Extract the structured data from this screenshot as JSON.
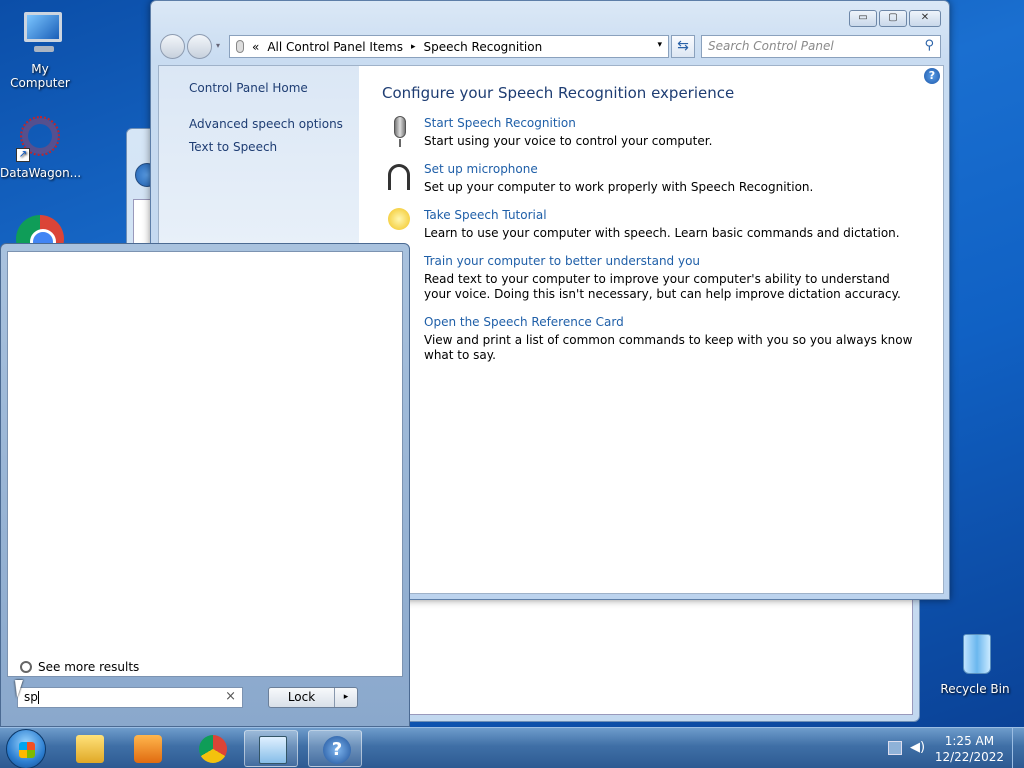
{
  "desktop": {
    "icons": [
      {
        "label": "My Computer"
      },
      {
        "label": "DataWagon..."
      },
      {
        "label": "Recycle Bin"
      }
    ]
  },
  "window": {
    "caption": {
      "minimize": "▭",
      "maximize": "▢",
      "close": "✕"
    },
    "address": {
      "chevrons": "«",
      "crumb1": "All Control Panel Items",
      "separator": "▸",
      "crumb2": "Speech Recognition",
      "dropdown": "▾"
    },
    "refresh": "⇆",
    "search_placeholder": "Search Control Panel",
    "search_icon": "⚲",
    "left_links": [
      "Control Panel Home",
      "Advanced speech options",
      "Text to Speech"
    ],
    "help": "?",
    "heading": "Configure your Speech Recognition experience",
    "tasks": [
      {
        "icon": "microphone-icon",
        "link": "Start Speech Recognition",
        "desc": "Start using your voice to control your computer."
      },
      {
        "icon": "headset-icon",
        "link": "Set up microphone",
        "desc": "Set up your computer to work properly with Speech Recognition."
      },
      {
        "icon": "lightbulb-icon",
        "link": "Take Speech Tutorial",
        "desc": "Learn to use your computer with speech.  Learn basic commands and dictation."
      },
      {
        "icon": "none",
        "link": "Train your computer to better understand you",
        "desc": "Read text to your computer to improve your computer's ability to understand your voice. Doing this isn't necessary, but can help improve dictation accuracy."
      },
      {
        "icon": "none",
        "link": "Open the Speech Reference Card",
        "desc": "View and print a list of common commands to keep with you so you always know what to say."
      }
    ]
  },
  "start_menu": {
    "see_more": "See more results",
    "search_value": "sp",
    "clear": "×",
    "lock_label": "Lock",
    "lock_arrow": "▸"
  },
  "taskbar": {
    "clock_time": "1:25 AM",
    "clock_date": "12/22/2022",
    "help_glyph": "?",
    "volume_glyph": "◀)"
  }
}
